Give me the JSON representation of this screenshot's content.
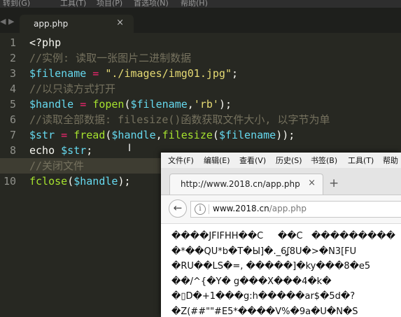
{
  "editor": {
    "menu": [
      "转到(G)",
      "工具(T)",
      "项目(P)",
      "首选项(N)",
      "帮助(H)"
    ],
    "nav_arrows": "◀ ▶",
    "tab": {
      "title": "app.php",
      "close": "×"
    },
    "active_line": 9,
    "line_numbers": [
      "1",
      "2",
      "3",
      "4",
      "5",
      "6",
      "7",
      "8",
      "9",
      "10"
    ],
    "code_lines": [
      [
        {
          "t": "<?php",
          "c": "pl"
        }
      ],
      [
        {
          "t": "//实例: 读取一张图片二进制数据",
          "c": "cm"
        }
      ],
      [
        {
          "t": "$filename",
          "c": "var"
        },
        {
          "t": " = ",
          "c": "op"
        },
        {
          "t": "\"./images/img01.jpg\"",
          "c": "str"
        },
        {
          "t": ";",
          "c": "pl"
        }
      ],
      [
        {
          "t": "//以只读方式打开",
          "c": "cm"
        }
      ],
      [
        {
          "t": "$handle",
          "c": "var"
        },
        {
          "t": " = ",
          "c": "op"
        },
        {
          "t": "fopen",
          "c": "fn"
        },
        {
          "t": "(",
          "c": "pl"
        },
        {
          "t": "$filename",
          "c": "var"
        },
        {
          "t": ",",
          "c": "pl"
        },
        {
          "t": "'rb'",
          "c": "str"
        },
        {
          "t": ");",
          "c": "pl"
        }
      ],
      [
        {
          "t": "//读取全部数据: filesize()函数获取文件大小, 以字节为单",
          "c": "cm"
        }
      ],
      [
        {
          "t": "$str",
          "c": "var"
        },
        {
          "t": " = ",
          "c": "op"
        },
        {
          "t": "fread",
          "c": "fn"
        },
        {
          "t": "(",
          "c": "pl"
        },
        {
          "t": "$handle",
          "c": "var"
        },
        {
          "t": ",",
          "c": "pl"
        },
        {
          "t": "filesize",
          "c": "fn"
        },
        {
          "t": "(",
          "c": "pl"
        },
        {
          "t": "$filename",
          "c": "var"
        },
        {
          "t": "));",
          "c": "pl"
        }
      ],
      [
        {
          "t": "echo ",
          "c": "pl"
        },
        {
          "t": "$str",
          "c": "var"
        },
        {
          "t": ";",
          "c": "pl"
        }
      ],
      [
        {
          "t": "//关闭文件",
          "c": "cm"
        }
      ],
      [
        {
          "t": "fclose",
          "c": "fn"
        },
        {
          "t": "(",
          "c": "pl"
        },
        {
          "t": "$handle",
          "c": "var"
        },
        {
          "t": ");",
          "c": "pl"
        }
      ]
    ]
  },
  "browser": {
    "menu": [
      "文件(F)",
      "编辑(E)",
      "查看(V)",
      "历史(S)",
      "书签(B)",
      "工具(T)",
      "帮助"
    ],
    "tab": {
      "title": "http://www.2018.cn/app.php",
      "close": "×"
    },
    "new_tab": "+",
    "back_icon": "←",
    "info_icon": "i",
    "url": {
      "host": "www.2018.cn",
      "path": "/app.php"
    },
    "content_lines": [
      "����JFIFHH��C     ��C   ���������",
      "�*��QU*b�T�Ы]�._6ʆ8U�>�N3[FU",
      "�RU��LS�=, �����]�ky���8�e5",
      "��/^{�Y� g���X���4�k�",
      "�▯D�+1���g:h�����ar$�5d�?",
      "�Z(##\"\"#E5*����V%�9a�U�N�S"
    ]
  }
}
